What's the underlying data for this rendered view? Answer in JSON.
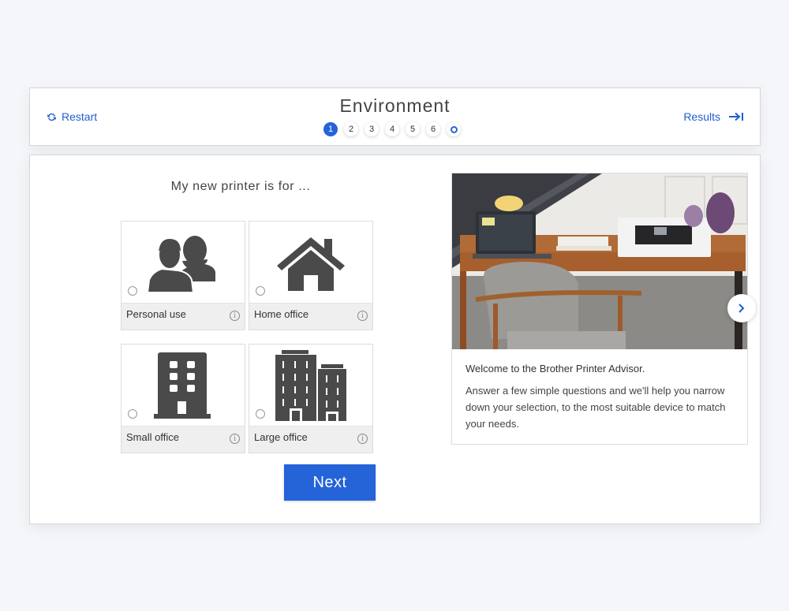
{
  "header": {
    "title": "Environment",
    "restart_label": "Restart",
    "results_label": "Results",
    "steps": [
      {
        "label": "1",
        "state": "active"
      },
      {
        "label": "2",
        "state": "pending"
      },
      {
        "label": "3",
        "state": "pending"
      },
      {
        "label": "4",
        "state": "pending"
      },
      {
        "label": "5",
        "state": "pending"
      },
      {
        "label": "6",
        "state": "pending"
      },
      {
        "label": "",
        "state": "final"
      }
    ]
  },
  "question": {
    "text": "My new printer is for ...",
    "options": [
      {
        "label": "Personal use",
        "icon": "people-icon",
        "selected": false
      },
      {
        "label": "Home office",
        "icon": "house-icon",
        "selected": false
      },
      {
        "label": "Small office",
        "icon": "building-icon",
        "selected": false
      },
      {
        "label": "Large office",
        "icon": "buildings-icon",
        "selected": false
      }
    ],
    "next_label": "Next"
  },
  "info_card": {
    "image_alt": "Desk with laptop and printer",
    "title": "Welcome to the Brother Printer Advisor.",
    "body": "Answer a few simple questions and we'll help you narrow down your selection, to the most suitable device to match your needs."
  },
  "colors": {
    "accent": "#2563d9",
    "link": "#1f5fd0",
    "icon": "#4a4a4a"
  }
}
